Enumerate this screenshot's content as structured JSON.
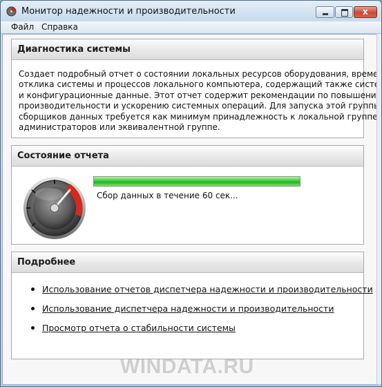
{
  "window": {
    "title": "Монитор надежности и производительности",
    "buttons": {
      "minimize": "",
      "maximize": "",
      "close": "x"
    }
  },
  "menu": {
    "items": [
      "Файл",
      "Справка"
    ]
  },
  "diagnostics": {
    "title": "Диагностика системы",
    "description": [
      "Создает подробный отчет о состоянии локальных ресурсов оборудования, времени",
      "отклика системы и процессов локального компьютера, содержащий также системные",
      "и конфигурационные данные.  Этот отчет содержит рекомендации по повышению",
      "производительности и ускорению системных операций. Для запуска этой группы",
      "сборщиков данных требуется как минимум принадлежность к локальной группе",
      "администраторов или эквивалентной группе."
    ]
  },
  "report_status": {
    "title": "Состояние отчета",
    "progress_fraction": 1.0,
    "status_text": "Сбор данных в течение 60 сек...",
    "icon": "gauge-icon"
  },
  "more": {
    "title": "Подробнее",
    "links": [
      "Использование отчетов диспетчера надежности и производительности",
      "Использование диспетчера надежности и производительности",
      "Просмотр отчета о стабильности системы"
    ]
  },
  "watermark": "WINDATA.RU",
  "colors": {
    "progress_green": "#38c83a",
    "gauge_red": "#d32a1e",
    "titlebar": "#c6daec"
  }
}
